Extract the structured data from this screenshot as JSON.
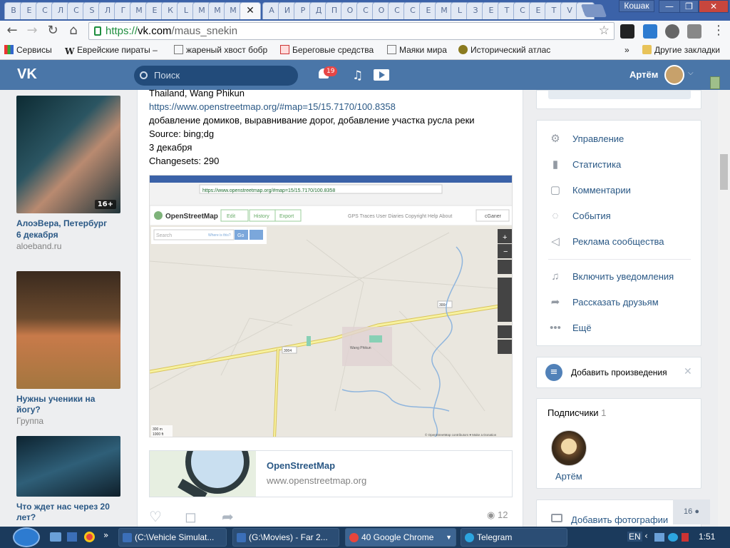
{
  "browser": {
    "tab_letters": [
      "В",
      "Е",
      "С",
      "Л",
      "С",
      "S",
      "Л",
      "Г",
      "М",
      "Е",
      "К",
      "L",
      "М",
      "М",
      "М",
      "✕",
      "А",
      "И",
      "Р",
      "Д",
      "П",
      "О",
      "С",
      "О",
      "С",
      "С",
      "Е",
      "М",
      "L",
      "З",
      "Е",
      "Т",
      "С",
      "Е",
      "Т",
      "V",
      "С"
    ],
    "active_tab_close": "✕",
    "window_user": "Кошак",
    "window_controls": [
      "—",
      "❐",
      "✕"
    ],
    "url_scheme": "https://",
    "url_host": "vk.com",
    "url_path": "/maus_snekin",
    "bookmarks": [
      {
        "label": "Сервисы",
        "icon": "apps-icon"
      },
      {
        "label": "Еврейские пираты –",
        "icon": "wikipedia-icon"
      },
      {
        "label": "жареный хвост бобр",
        "icon": "page-icon"
      },
      {
        "label": "Береговые средства",
        "icon": "page-icon"
      },
      {
        "label": "Маяки мира",
        "icon": "page-icon"
      },
      {
        "label": "Исторический атлас",
        "icon": "globe-icon"
      }
    ],
    "bookmarks_overflow": "»",
    "other_bookmarks": "Другие закладки"
  },
  "vk_header": {
    "logo": "VK",
    "search_placeholder": "Поиск",
    "notifications_count": "19",
    "user_name": "Артём",
    "caret": "⌵"
  },
  "left_ads": [
    {
      "title": "АлоэВера, Петербург",
      "subtitle": "6 декабря",
      "domain": "aloeband.ru",
      "badge": "16+"
    },
    {
      "title": "Нужны ученики на йогу?",
      "subtitle": "Группа",
      "domain": ""
    },
    {
      "title": "Что ждет нас через 20 лет?",
      "subtitle": "",
      "domain": ""
    }
  ],
  "post": {
    "lines": [
      "Thailand, Wang Phikun",
      "https://www.openstreetmap.org/#map=15/15.7170/100.8358",
      "добавление домиков, выравнивание дорог, добавление участка русла реки",
      "Source: bing;dg",
      "3 декабря",
      "Changesets: 290"
    ],
    "screenshot": {
      "url": "https://www.openstreetmap.org/#map=15/15.7170/100.8358",
      "brand": "OpenStreetMap",
      "edit": "Edit",
      "history": "History",
      "export": "Export",
      "top_links": "GPS Traces  User Diaries  Copyright  Help  About",
      "user": "cGaner",
      "search_placeholder": "Search",
      "where_is_this": "Where is this?",
      "go": "Go",
      "road_label_1": "3004",
      "road_label_2": "3004",
      "village": "Wang Phikun",
      "scale_1": "300 m",
      "scale_2": "1000 ft",
      "attribution": "© OpenStreetMap contributors ♥ Make a Donation"
    },
    "link_card": {
      "title": "OpenStreetMap",
      "url": "www.openstreetmap.org"
    },
    "views": "12"
  },
  "right_menu": {
    "items": [
      {
        "label": "Управление",
        "icon": "gear-icon"
      },
      {
        "label": "Статистика",
        "icon": "bar-chart-icon"
      },
      {
        "label": "Комментарии",
        "icon": "comment-icon"
      },
      {
        "label": "События",
        "icon": "event-icon"
      },
      {
        "label": "Реклама сообщества",
        "icon": "megaphone-icon"
      },
      {
        "label": "Включить уведомления",
        "icon": "bell-icon"
      },
      {
        "label": "Рассказать друзьям",
        "icon": "share-icon"
      },
      {
        "label": "Ещё",
        "icon": "more-icon"
      }
    ],
    "add_works": "Добавить произведения",
    "subscribers_title": "Подписчики",
    "subscribers_count": "1",
    "subscriber_name": "Артём",
    "add_photos": "Добавить фотографии",
    "online_count": "16"
  },
  "taskbar": {
    "items": [
      {
        "label": "(C:\\Vehicle Simulat..."
      },
      {
        "label": "(G:\\Movies) - Far 2..."
      },
      {
        "label": "40 Google Chrome"
      },
      {
        "label": "Telegram"
      }
    ],
    "lang": "EN",
    "time": "1:51"
  },
  "colors": {
    "vk_blue": "#4a76a8",
    "link": "#2a5885",
    "tabstrip": "#3b62a8"
  }
}
